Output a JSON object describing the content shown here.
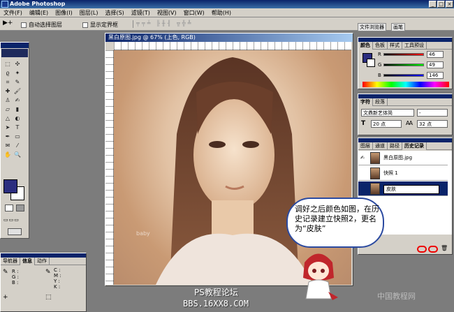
{
  "app": {
    "title": "Adobe Photoshop"
  },
  "menu": [
    "文件(F)",
    "编辑(E)",
    "图像(I)",
    "图层(L)",
    "选择(S)",
    "滤镜(T)",
    "视图(V)",
    "窗口(W)",
    "帮助(H)"
  ],
  "options": {
    "auto_select": "自动选择图层",
    "show_bounds": "显示定界框"
  },
  "palette_well": {
    "tab1": "文件浏览器",
    "tab2": "画笔"
  },
  "document": {
    "title": "黑白原图.jpg @ 67% (上色, RGB)"
  },
  "color_panel": {
    "tabs": [
      "颜色",
      "色板",
      "样式",
      "工具预设"
    ],
    "fg_color": "#2b2d7f",
    "channels": [
      {
        "label": "R",
        "value": "46"
      },
      {
        "label": "G",
        "value": "49"
      },
      {
        "label": "B",
        "value": "146"
      }
    ]
  },
  "char_panel": {
    "tabs": [
      "字符",
      "段落"
    ],
    "font": "文鼎新艺体简",
    "style": "-",
    "size_icon": "T",
    "size": "20 点",
    "leading": "32 点"
  },
  "history_panel": {
    "tabs": [
      "图层",
      "通道",
      "路径",
      "历史记录"
    ],
    "items": [
      {
        "label": "黑白原图.jpg"
      },
      {
        "label": "快照 1"
      },
      {
        "label": "皮肤"
      }
    ]
  },
  "nav_panel": {
    "tabs": [
      "导航器",
      "信息",
      "动作"
    ],
    "labels": [
      "R :",
      "G :",
      "B :",
      "C :",
      "M :",
      "Y :",
      "K :"
    ]
  },
  "callout": {
    "text": "调好之后颜色如图，在历史记录建立快照2，更名为“皮肤”"
  },
  "watermark": {
    "forum": "PS教程论坛",
    "url": "BBS.16XX8.COM",
    "site": "中国教程网"
  },
  "photo": {
    "caption": "baby"
  }
}
